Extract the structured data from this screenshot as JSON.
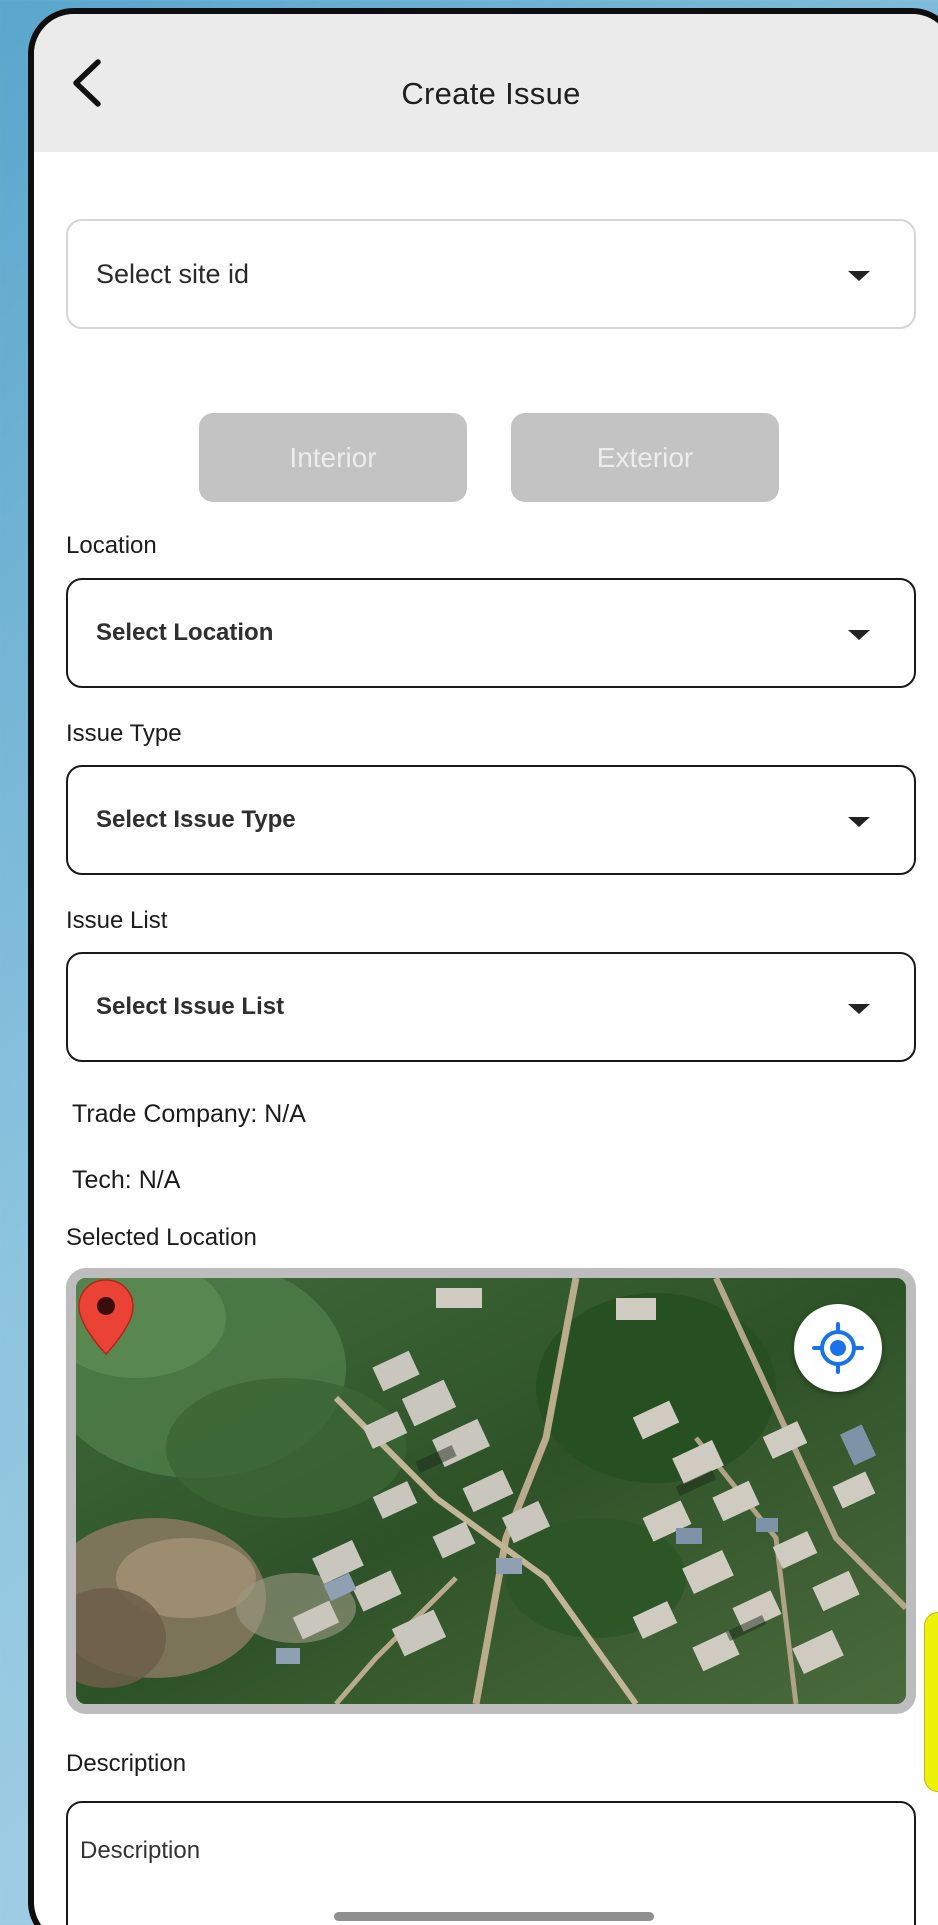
{
  "header": {
    "title": "Create Issue",
    "back_icon": "chevron-left-icon"
  },
  "site_select": {
    "placeholder": "Select site id",
    "caret_icon": "caret-down-icon"
  },
  "segments": {
    "interior": "Interior",
    "exterior": "Exterior",
    "disabled_color": "#c3c3c3"
  },
  "location": {
    "label": "Location",
    "placeholder": "Select Location"
  },
  "issue_type": {
    "label": "Issue Type",
    "placeholder": "Select Issue Type"
  },
  "issue_list": {
    "label": "Issue List",
    "placeholder": "Select Issue List"
  },
  "info": {
    "trade_company": "Trade Company: N/A",
    "tech": "Tech: N/A"
  },
  "map": {
    "label": "Selected Location",
    "locate_icon": "my-location-icon",
    "pin_icon": "map-pin-icon",
    "pin_color": "#ea4335",
    "locate_color": "#1a73e8"
  },
  "description": {
    "label": "Description",
    "placeholder": "Description"
  },
  "colors": {
    "appbar": "#ebebeb",
    "side_tab": "#eef20a"
  }
}
